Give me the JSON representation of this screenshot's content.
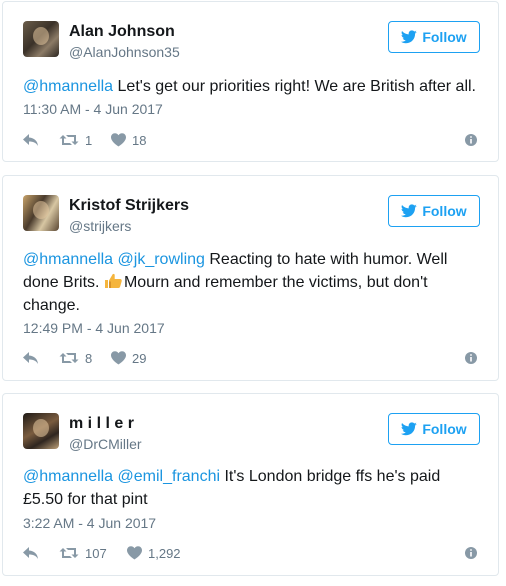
{
  "colors": {
    "accent": "#1da1f2",
    "mention": "#1b95e0",
    "muted": "#657786",
    "text": "#14171a",
    "border": "#e1e8ed"
  },
  "tweets": [
    {
      "name": "Alan Johnson",
      "handle": "@AlanJohnson35",
      "follow_label": "Follow",
      "mentions": [
        "@hmannella"
      ],
      "text": "Let's get our priorities right! We are British after all.",
      "time": "11:30 AM - 4 Jun 2017",
      "retweets": "1",
      "likes": "18",
      "icons": [
        "reply-icon",
        "retweet-icon",
        "heart-icon",
        "info-icon"
      ]
    },
    {
      "name": "Kristof Strijkers",
      "handle": "@strijkers",
      "follow_label": "Follow",
      "mentions": [
        "@hmannella",
        "@jk_rowling"
      ],
      "text_a": "Reacting to hate with humor. Well done Brits.",
      "emoji": "thumbs-up-emoji",
      "text_b": "Mourn and remember the victims, but don't change.",
      "time": "12:49 PM - 4 Jun 2017",
      "retweets": "8",
      "likes": "29"
    },
    {
      "name": "m i l l e r",
      "handle": "@DrCMiller",
      "follow_label": "Follow",
      "mentions": [
        "@hmannella",
        "@emil_franchi"
      ],
      "text": "It's London bridge ffs he's paid £5.50 for that pint",
      "time": "3:22 AM - 4 Jun 2017",
      "retweets": "107",
      "likes": "1,292"
    }
  ]
}
